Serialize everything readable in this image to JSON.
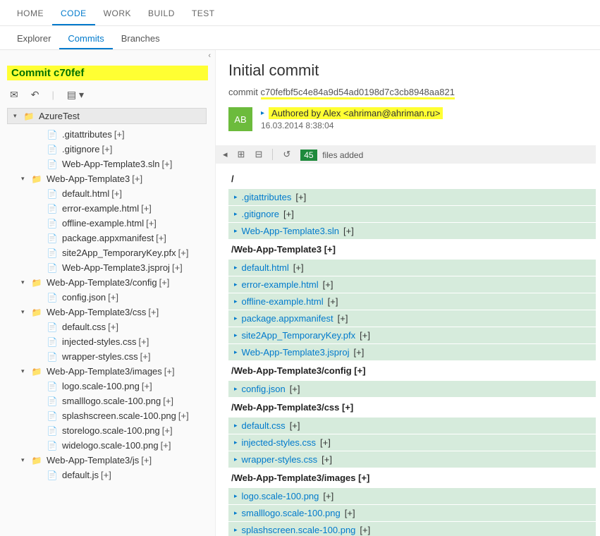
{
  "top_tabs": {
    "items": [
      "HOME",
      "CODE",
      "WORK",
      "BUILD",
      "TEST"
    ],
    "active": 1
  },
  "sub_tabs": {
    "items": [
      "Explorer",
      "Commits",
      "Branches"
    ],
    "active": 1
  },
  "commit_header": "Commit c70fef",
  "tree": [
    {
      "type": "root",
      "indent": 0,
      "label": "AzureTest"
    },
    {
      "type": "file",
      "indent": 2,
      "label": ".gitattributes",
      "suffix": "[+]"
    },
    {
      "type": "file",
      "indent": 2,
      "label": ".gitignore",
      "suffix": "[+]"
    },
    {
      "type": "file",
      "indent": 2,
      "label": "Web-App-Template3.sln",
      "suffix": "[+]"
    },
    {
      "type": "folder",
      "indent": 1,
      "label": "Web-App-Template3",
      "suffix": "[+]"
    },
    {
      "type": "file",
      "indent": 2,
      "label": "default.html",
      "suffix": "[+]"
    },
    {
      "type": "file",
      "indent": 2,
      "label": "error-example.html",
      "suffix": "[+]"
    },
    {
      "type": "file",
      "indent": 2,
      "label": "offline-example.html",
      "suffix": "[+]"
    },
    {
      "type": "file",
      "indent": 2,
      "label": "package.appxmanifest",
      "suffix": "[+]"
    },
    {
      "type": "file",
      "indent": 2,
      "label": "site2App_TemporaryKey.pfx",
      "suffix": "[+]"
    },
    {
      "type": "file",
      "indent": 2,
      "label": "Web-App-Template3.jsproj",
      "suffix": "[+]"
    },
    {
      "type": "folder",
      "indent": 1,
      "label": "Web-App-Template3/config",
      "suffix": "[+]"
    },
    {
      "type": "file",
      "indent": 2,
      "label": "config.json",
      "suffix": "[+]"
    },
    {
      "type": "folder",
      "indent": 1,
      "label": "Web-App-Template3/css",
      "suffix": "[+]"
    },
    {
      "type": "file",
      "indent": 2,
      "label": "default.css",
      "suffix": "[+]"
    },
    {
      "type": "file",
      "indent": 2,
      "label": "injected-styles.css",
      "suffix": "[+]"
    },
    {
      "type": "file",
      "indent": 2,
      "label": "wrapper-styles.css",
      "suffix": "[+]"
    },
    {
      "type": "folder",
      "indent": 1,
      "label": "Web-App-Template3/images",
      "suffix": "[+]"
    },
    {
      "type": "file",
      "indent": 2,
      "label": "logo.scale-100.png",
      "suffix": "[+]"
    },
    {
      "type": "file",
      "indent": 2,
      "label": "smalllogo.scale-100.png",
      "suffix": "[+]"
    },
    {
      "type": "file",
      "indent": 2,
      "label": "splashscreen.scale-100.png",
      "suffix": "[+]"
    },
    {
      "type": "file",
      "indent": 2,
      "label": "storelogo.scale-100.png",
      "suffix": "[+]"
    },
    {
      "type": "file",
      "indent": 2,
      "label": "widelogo.scale-100.png",
      "suffix": "[+]"
    },
    {
      "type": "folder",
      "indent": 1,
      "label": "Web-App-Template3/js",
      "suffix": "[+]"
    },
    {
      "type": "file",
      "indent": 2,
      "label": "default.js",
      "suffix": "[+]"
    }
  ],
  "commit": {
    "title": "Initial commit",
    "id_prefix": "commit ",
    "id_hash": "c70fefbf5c4e84a9d54ad0198d7c3cb8948aa821",
    "avatar_initials": "AB",
    "author_line": "Authored by Alex <ahriman@ahriman.ru>",
    "date": "16.03.2014 8:38:04",
    "badge_count": "45",
    "badge_text": "files added"
  },
  "diff": [
    {
      "type": "head",
      "label": "/"
    },
    {
      "type": "file",
      "name": ".gitattributes",
      "suffix": "[+]"
    },
    {
      "type": "file",
      "name": ".gitignore",
      "suffix": "[+]"
    },
    {
      "type": "file",
      "name": "Web-App-Template3.sln",
      "suffix": "[+]"
    },
    {
      "type": "head",
      "label": "/Web-App-Template3 [+]"
    },
    {
      "type": "file",
      "name": "default.html",
      "suffix": "[+]"
    },
    {
      "type": "file",
      "name": "error-example.html",
      "suffix": "[+]"
    },
    {
      "type": "file",
      "name": "offline-example.html",
      "suffix": "[+]"
    },
    {
      "type": "file",
      "name": "package.appxmanifest",
      "suffix": "[+]"
    },
    {
      "type": "file",
      "name": "site2App_TemporaryKey.pfx",
      "suffix": "[+]"
    },
    {
      "type": "file",
      "name": "Web-App-Template3.jsproj",
      "suffix": "[+]"
    },
    {
      "type": "head",
      "label": "/Web-App-Template3/config [+]"
    },
    {
      "type": "file",
      "name": "config.json",
      "suffix": "[+]"
    },
    {
      "type": "head",
      "label": "/Web-App-Template3/css [+]"
    },
    {
      "type": "file",
      "name": "default.css",
      "suffix": "[+]"
    },
    {
      "type": "file",
      "name": "injected-styles.css",
      "suffix": "[+]"
    },
    {
      "type": "file",
      "name": "wrapper-styles.css",
      "suffix": "[+]"
    },
    {
      "type": "head",
      "label": "/Web-App-Template3/images [+]"
    },
    {
      "type": "file",
      "name": "logo.scale-100.png",
      "suffix": "[+]"
    },
    {
      "type": "file",
      "name": "smalllogo.scale-100.png",
      "suffix": "[+]"
    },
    {
      "type": "file",
      "name": "splashscreen.scale-100.png",
      "suffix": "[+]"
    }
  ]
}
